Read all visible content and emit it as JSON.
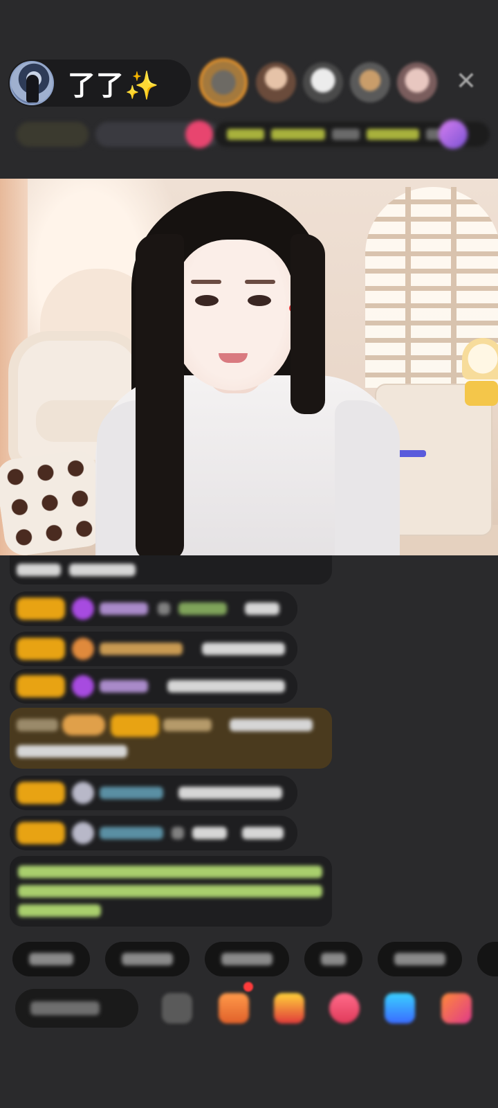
{
  "host": {
    "name": "了了✨",
    "avatar_icon": "host-avatar"
  },
  "header": {
    "close_icon": "✕"
  },
  "colors": {
    "level_badge": "#e8a313",
    "background": "#2a2a2c",
    "highlight_message": "#4a3a1e"
  }
}
